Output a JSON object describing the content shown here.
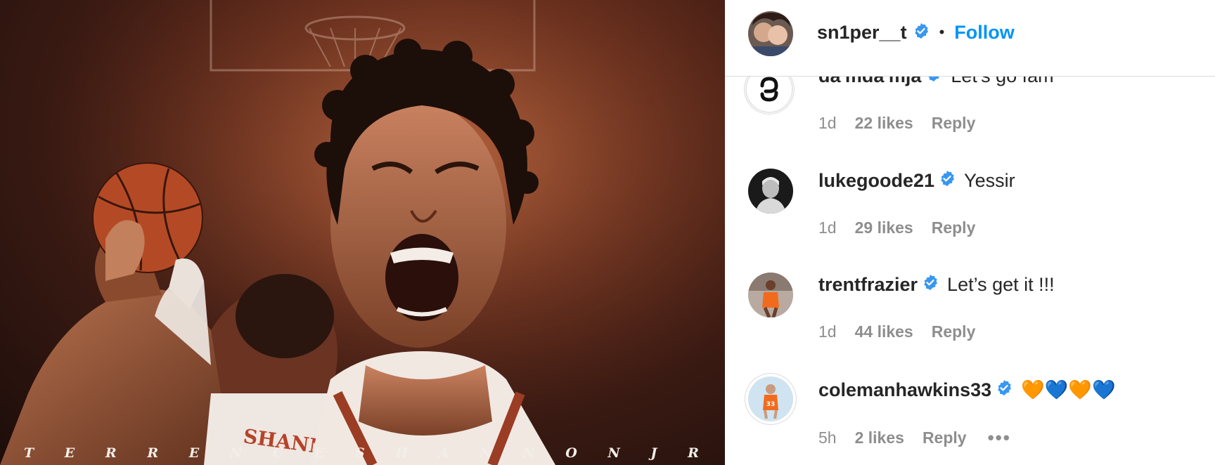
{
  "post": {
    "caption_letters": [
      "T",
      "E",
      "R",
      "R",
      "E",
      "N",
      "C",
      "E",
      "S",
      "H",
      "A",
      "N",
      "N",
      "O",
      "N",
      "J",
      "R"
    ],
    "jersey_text": "SHANNON"
  },
  "header": {
    "username": "sn1per__t",
    "separator": "•",
    "follow_label": "Follow"
  },
  "comments": [
    {
      "username": "da'mda'mja",
      "text": "Let's go fam",
      "time": "1d",
      "likes": "22 likes",
      "reply": "Reply",
      "avatar_icon": "link-logo-icon"
    },
    {
      "username": "lukegoode21",
      "text": "Yessir",
      "time": "1d",
      "likes": "29 likes",
      "reply": "Reply",
      "avatar_icon": "player-photo"
    },
    {
      "username": "trentfrazier",
      "text": "Let’s get it !!!",
      "time": "1d",
      "likes": "44 likes",
      "reply": "Reply",
      "avatar_icon": "player-photo"
    },
    {
      "username": "colemanhawkins33",
      "text": "🧡💙🧡💙",
      "time": "5h",
      "likes": "2 likes",
      "reply": "Reply",
      "more": "•••",
      "avatar_icon": "player-photo"
    }
  ],
  "colors": {
    "accent": "#0095f6",
    "verified": "#3897f0",
    "muted": "#8e8e8e"
  }
}
